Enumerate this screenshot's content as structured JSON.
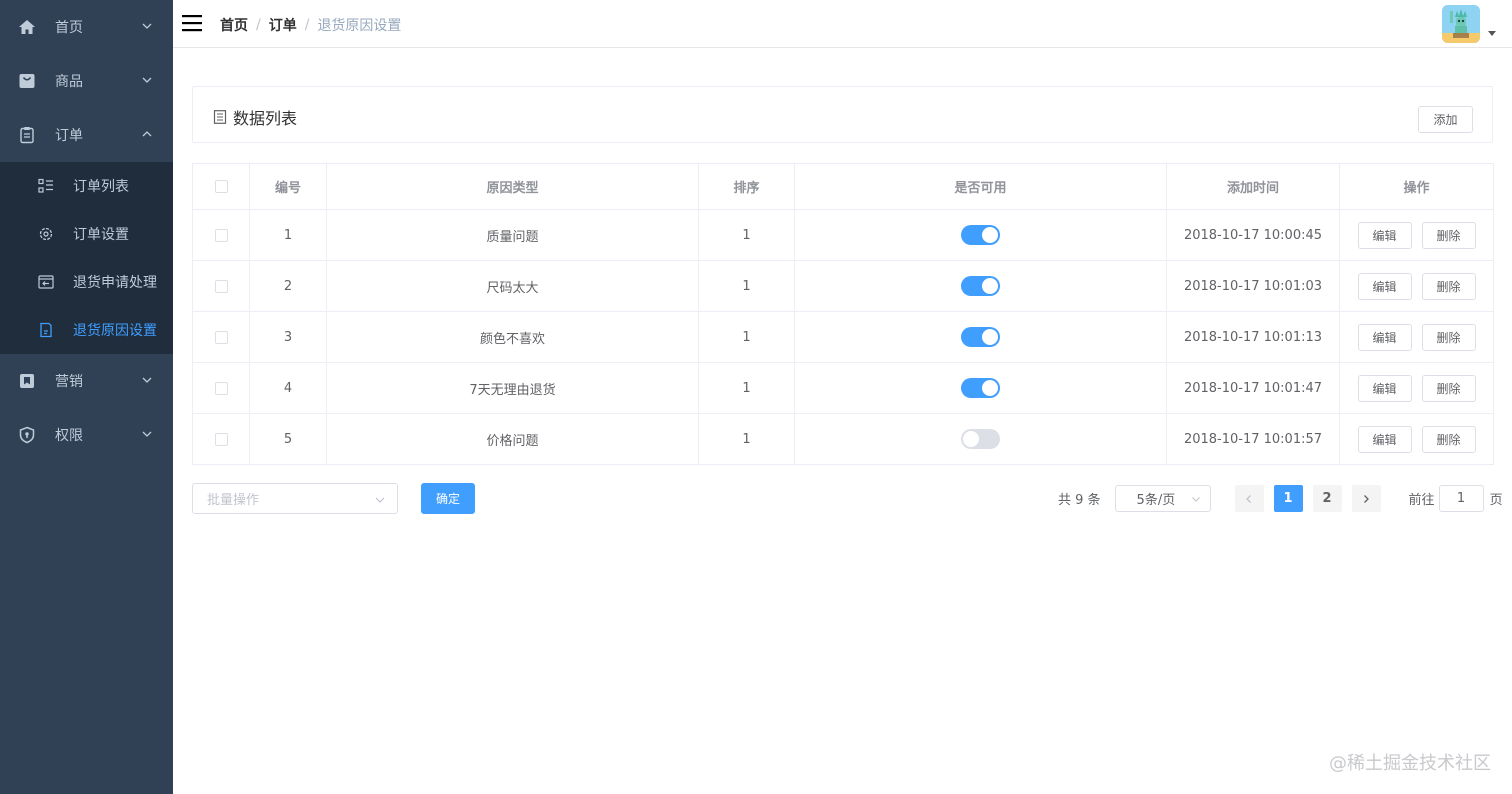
{
  "sidebar": {
    "menu": [
      {
        "label": "首页",
        "icon": "home-icon"
      },
      {
        "label": "商品",
        "icon": "bag-icon"
      },
      {
        "label": "订单",
        "icon": "clipboard-icon"
      },
      {
        "label": "营销",
        "icon": "bookmark-icon"
      },
      {
        "label": "权限",
        "icon": "shield-icon"
      }
    ],
    "order_submenu": [
      {
        "label": "订单列表",
        "icon": "list-icon"
      },
      {
        "label": "订单设置",
        "icon": "gear-icon"
      },
      {
        "label": "退货申请处理",
        "icon": "return-box-icon"
      },
      {
        "label": "退货原因设置",
        "icon": "return-doc-icon",
        "active": true
      }
    ],
    "bg_color": "#304156",
    "submenu_bg_color": "#1f2d3d",
    "active_color": "#409eff"
  },
  "header": {
    "breadcrumb": [
      "首页",
      "订单",
      "退货原因设置"
    ]
  },
  "card": {
    "title": "数据列表",
    "add_label": "添加"
  },
  "table": {
    "headers": [
      "编号",
      "原因类型",
      "排序",
      "是否可用",
      "添加时间",
      "操作"
    ],
    "edit_label": "编辑",
    "delete_label": "删除",
    "rows": [
      {
        "id": "1",
        "reason": "质量问题",
        "sort": "1",
        "enabled": true,
        "time": "2018-10-17 10:00:45"
      },
      {
        "id": "2",
        "reason": "尺码太大",
        "sort": "1",
        "enabled": true,
        "time": "2018-10-17 10:01:03"
      },
      {
        "id": "3",
        "reason": "颜色不喜欢",
        "sort": "1",
        "enabled": true,
        "time": "2018-10-17 10:01:13"
      },
      {
        "id": "4",
        "reason": "7天无理由退货",
        "sort": "1",
        "enabled": true,
        "time": "2018-10-17 10:01:47"
      },
      {
        "id": "5",
        "reason": "价格问题",
        "sort": "1",
        "enabled": false,
        "time": "2018-10-17 10:01:57"
      }
    ]
  },
  "footer": {
    "batch_placeholder": "批量操作",
    "confirm_label": "确定",
    "total": "共 9 条",
    "page_size": "5条/页",
    "pages": [
      "1",
      "2"
    ],
    "current_page": "1",
    "goto_label": "前往",
    "goto_value": "1",
    "page_unit": "页"
  },
  "watermark": "@稀土掘金技术社区",
  "colors": {
    "primary": "#409eff",
    "switch_off": "#dcdfe6"
  }
}
